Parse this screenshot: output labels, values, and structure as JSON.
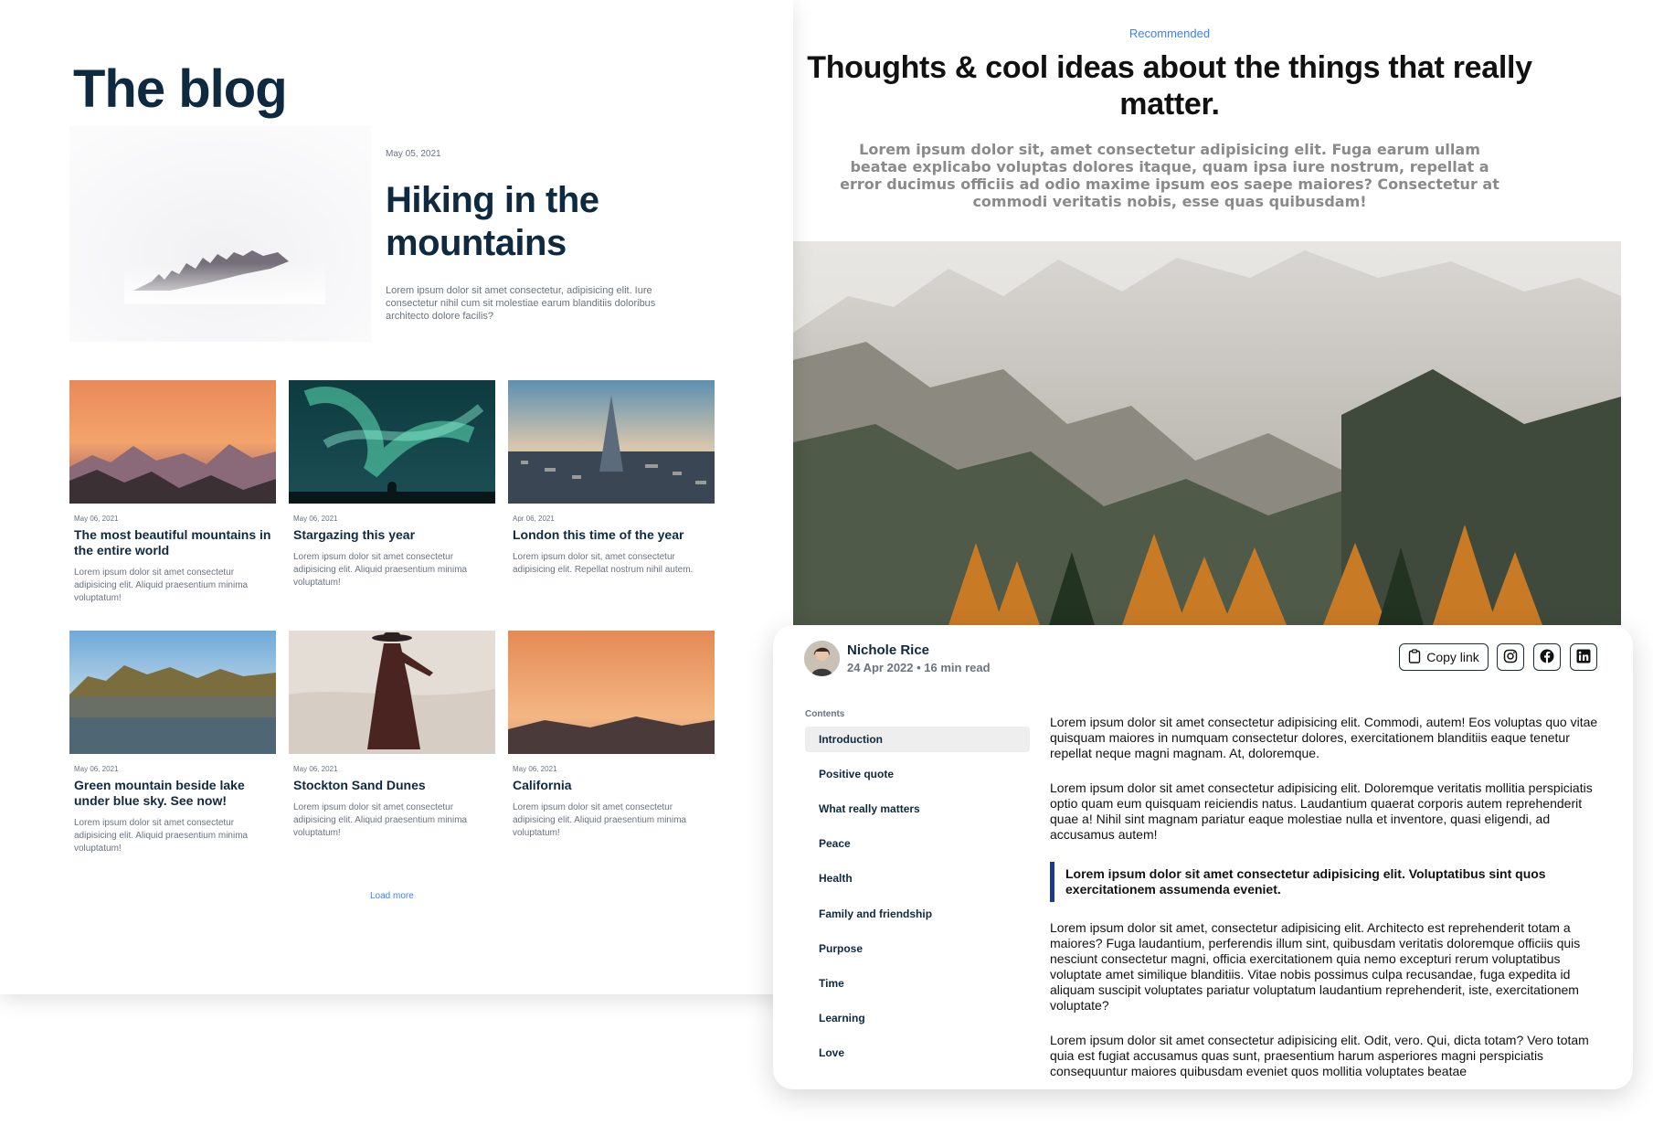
{
  "blog": {
    "title": "The blog",
    "featured": {
      "date": "May 05, 2021",
      "title": "Hiking in the mountains",
      "excerpt": "Lorem ipsum dolor sit amet consectetur, adipisicing elit. Iure consectetur nihil cum sit molestiae earum blanditiis doloribus architecto dolore facilis?"
    },
    "posts": [
      {
        "date": "May 06, 2021",
        "title": "The most beautiful mountains in the entire world",
        "excerpt": "Lorem ipsum dolor sit amet consectetur adipisicing elit. Aliquid praesentium minima voluptatum!"
      },
      {
        "date": "May 06, 2021",
        "title": "Stargazing this year",
        "excerpt": "Lorem ipsum dolor sit amet consectetur adipisicing elit. Aliquid praesentium minima voluptatum!"
      },
      {
        "date": "Apr 06, 2021",
        "title": "London this time of the year",
        "excerpt": "Lorem ipsum dolor sit, amet consectetur adipisicing elit. Repellat nostrum nihil autem."
      },
      {
        "date": "May 06, 2021",
        "title": "Green mountain beside lake under blue sky. See now!",
        "excerpt": "Lorem ipsum dolor sit amet consectetur adipisicing elit. Aliquid praesentium minima voluptatum!"
      },
      {
        "date": "May 06, 2021",
        "title": "Stockton Sand Dunes",
        "excerpt": "Lorem ipsum dolor sit amet consectetur adipisicing elit. Aliquid praesentium minima voluptatum!"
      },
      {
        "date": "May 06, 2021",
        "title": "California",
        "excerpt": "Lorem ipsum dolor sit amet consectetur adipisicing elit. Aliquid praesentium minima voluptatum!"
      }
    ],
    "load_more": "Load more"
  },
  "article": {
    "label": "Recommended",
    "heading": "Thoughts & cool ideas about the things that really matter.",
    "lead": "Lorem ipsum dolor sit, amet consectetur adipisicing elit. Fuga earum ullam beatae explicabo voluptas dolores itaque, quam ipsa iure nostrum, repellat a error ducimus officiis ad odio maxime ipsum eos saepe maiores? Consectetur at commodi veritatis nobis, esse quas quibusdam!",
    "author": "Nichole Rice",
    "meta": "24 Apr 2022 • 16 min read",
    "copy_link": "Copy link",
    "contents_label": "Contents",
    "toc": [
      "Introduction",
      "Positive quote",
      "What really matters",
      "Peace",
      "Health",
      "Family and friendship",
      "Purpose",
      "Time",
      "Learning",
      "Love"
    ],
    "paragraphs": [
      "Lorem ipsum dolor sit amet consectetur adipisicing elit. Commodi, autem! Eos voluptas quo vitae quisquam maiores in numquam consectetur dolores, exercitationem blanditiis eaque tenetur repellat neque magni magnam. At, doloremque.",
      "Lorem ipsum dolor sit amet consectetur adipisicing elit. Doloremque veritatis mollitia perspiciatis optio quam eum quisquam reiciendis natus. Laudantium quaerat corporis autem reprehenderit quae a! Nihil sint magnam pariatur eaque molestiae nulla et inventore, quasi eligendi, ad accusamus autem!",
      "Lorem ipsum dolor sit amet, consectetur adipisicing elit. Architecto est reprehenderit totam a maiores? Fuga laudantium, perferendis illum sint, quibusdam veritatis doloremque officiis quis nesciunt consectetur magni, officia exercitationem quia nemo excepturi rerum voluptatibus voluptate amet similique blanditiis. Vitae nobis possimus culpa recusandae, fuga expedita id aliquam suscipit voluptates pariatur voluptatum laudantium reprehenderit, iste, exercitationem voluptate?",
      "Lorem ipsum dolor sit amet consectetur adipisicing elit. Odit, vero. Qui, dicta totam? Vero totam quia est fugiat accusamus quas sunt, praesentium harum asperiores magni perspiciatis consequuntur maiores quibusdam eveniet quos mollitia voluptates beatae"
    ],
    "quote": "Lorem ipsum dolor sit amet consectetur adipisicing elit. Voluptatibus sint quos exercitationem assumenda eveniet."
  },
  "icons": {
    "clipboard": "clipboard-icon",
    "instagram": "instagram-icon",
    "facebook": "facebook-icon",
    "linkedin": "linkedin-icon"
  },
  "colors": {
    "heading_navy": "#0f2a40",
    "link_blue": "#3b82f6",
    "muted_gray": "#6b7280",
    "quote_bar": "#1e3a8a"
  }
}
